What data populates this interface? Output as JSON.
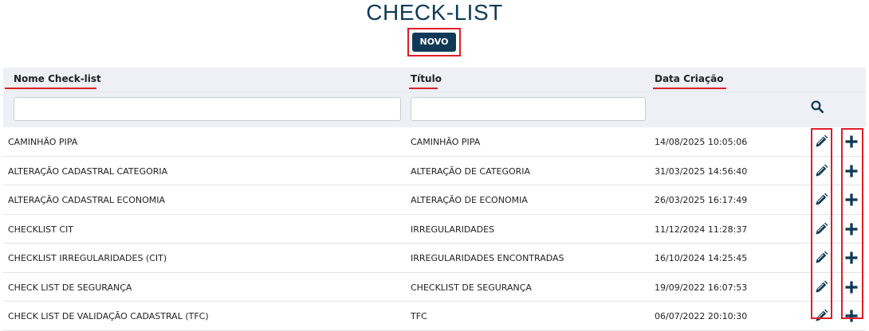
{
  "page": {
    "title": "CHECK-LIST",
    "new_button": "NOVO"
  },
  "table": {
    "headers": {
      "name": "Nome Check-list",
      "title": "Título",
      "created": "Data Criação"
    },
    "filters": {
      "name": "",
      "title": ""
    },
    "rows": [
      {
        "name": "CAMINHÃO PIPA",
        "title": "CAMINHÃO PIPA",
        "created": "14/08/2025 10:05:06"
      },
      {
        "name": "ALTERAÇÃO CADASTRAL CATEGORIA",
        "title": "ALTERAÇÃO DE CATEGORIA",
        "created": "31/03/2025 14:56:40"
      },
      {
        "name": "ALTERAÇÃO CADASTRAL ECONOMIA",
        "title": "ALTERAÇÃO DE ECONOMIA",
        "created": "26/03/2025 16:17:49"
      },
      {
        "name": "CHECKLIST CIT",
        "title": "IRREGULARIDADES",
        "created": "11/12/2024 11:28:37"
      },
      {
        "name": "CHECKLIST IRREGULARIDADES (CIT)",
        "title": "IRREGULARIDADES ENCONTRADAS",
        "created": "16/10/2024 14:25:45"
      },
      {
        "name": "CHECK LIST DE SEGURANÇA",
        "title": "CHECKLIST DE SEGURANÇA",
        "created": "19/09/2022 16:07:53"
      },
      {
        "name": "CHECK LIST DE VALIDAÇÃO CADASTRAL (TFC)",
        "title": "TFC",
        "created": "06/07/2022 20:10:30"
      }
    ],
    "row_actions": {
      "edit_icon": "pencil-icon",
      "add_icon": "plus-icon"
    }
  },
  "colors": {
    "accent": "#0f3a57",
    "highlight": "#e01e25",
    "header_bg": "#eef0f6"
  }
}
